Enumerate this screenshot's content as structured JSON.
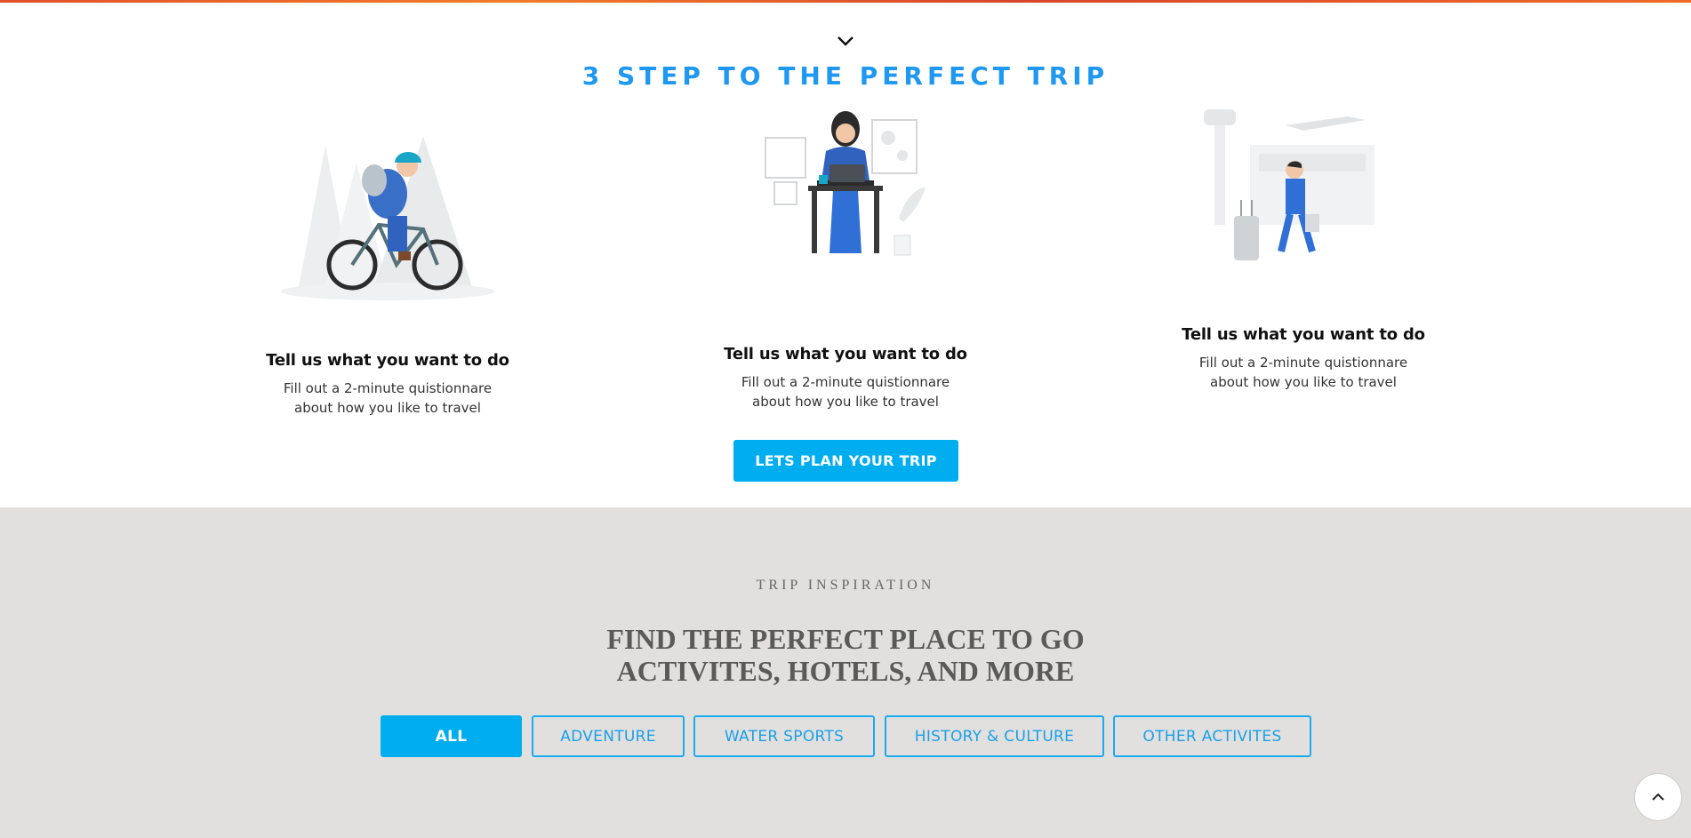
{
  "steps_section": {
    "title": "3 STEP TO THE PERFECT TRIP",
    "steps": [
      {
        "icon": "cyclist-illustration",
        "heading": "Tell us what you want to do",
        "text_line1": "Fill out a 2-minute quistionnare",
        "text_line2": "about how you like to travel"
      },
      {
        "icon": "woman-at-laptop-illustration",
        "heading": "Tell us what you want to do",
        "text_line1": "Fill out a 2-minute quistionnare",
        "text_line2": "about how you like to travel"
      },
      {
        "icon": "traveler-airport-illustration",
        "heading": "Tell us what you want to do",
        "text_line1": "Fill out a 2-minute quistionnare",
        "text_line2": "about how you like to travel"
      }
    ],
    "cta_label": "LETS PLAN YOUR TRIP"
  },
  "inspiration": {
    "eyebrow": "TRIP INSPIRATION",
    "headline_line1": "FIND THE PERFECT PLACE TO GO",
    "headline_line2": "ACTIVITES, HOTELS, AND MORE",
    "filters": [
      "ALL",
      "ADVENTURE",
      "WATER SPORTS",
      "HISTORY & CULTURE",
      "OTHER ACTIVITES"
    ],
    "active_filter": "ALL"
  },
  "colors": {
    "accent": "#00aef0",
    "title_blue": "#1e98f0",
    "section_bg": "#e1e0df"
  }
}
